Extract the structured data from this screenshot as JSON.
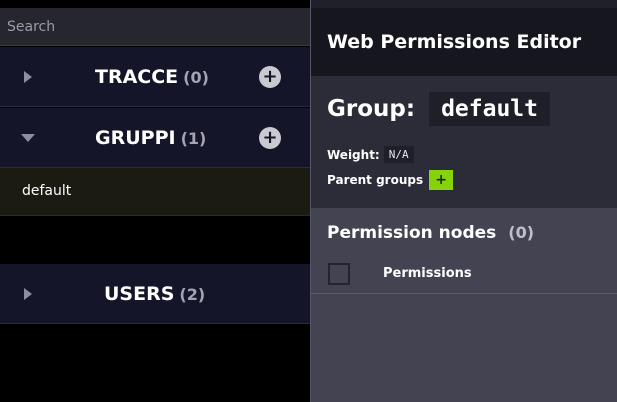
{
  "search": {
    "placeholder": "Search",
    "value": ""
  },
  "sidebar": {
    "sections": [
      {
        "name": "TRACCE",
        "count": "(0)",
        "expanded": false
      },
      {
        "name": "GRUPPI",
        "count": "(1)",
        "expanded": true,
        "items": [
          "default"
        ]
      },
      {
        "name": "USERS",
        "count": "(2)",
        "expanded": false
      }
    ]
  },
  "editor": {
    "title": "Web Permissions Editor",
    "group_label": "Group:",
    "group_name": "default",
    "weight_label": "Weight:",
    "weight_value": "N/A",
    "parent_groups_label": "Parent groups",
    "add_parent_symbol": "+",
    "permission_nodes_label": "Permission nodes",
    "permission_nodes_count": "(0)",
    "permissions_column": "Permissions"
  },
  "colors": {
    "sidebar_row": "#15152a",
    "selected_item": "#1b1b12",
    "editor_header": "#16161f",
    "group_card": "#2c2c38",
    "perm_section": "#434351",
    "accent_green": "#86d20c"
  },
  "icons": {
    "collapsed": "caret-right-icon",
    "expanded": "caret-down-icon",
    "add": "plus-circle-icon"
  }
}
